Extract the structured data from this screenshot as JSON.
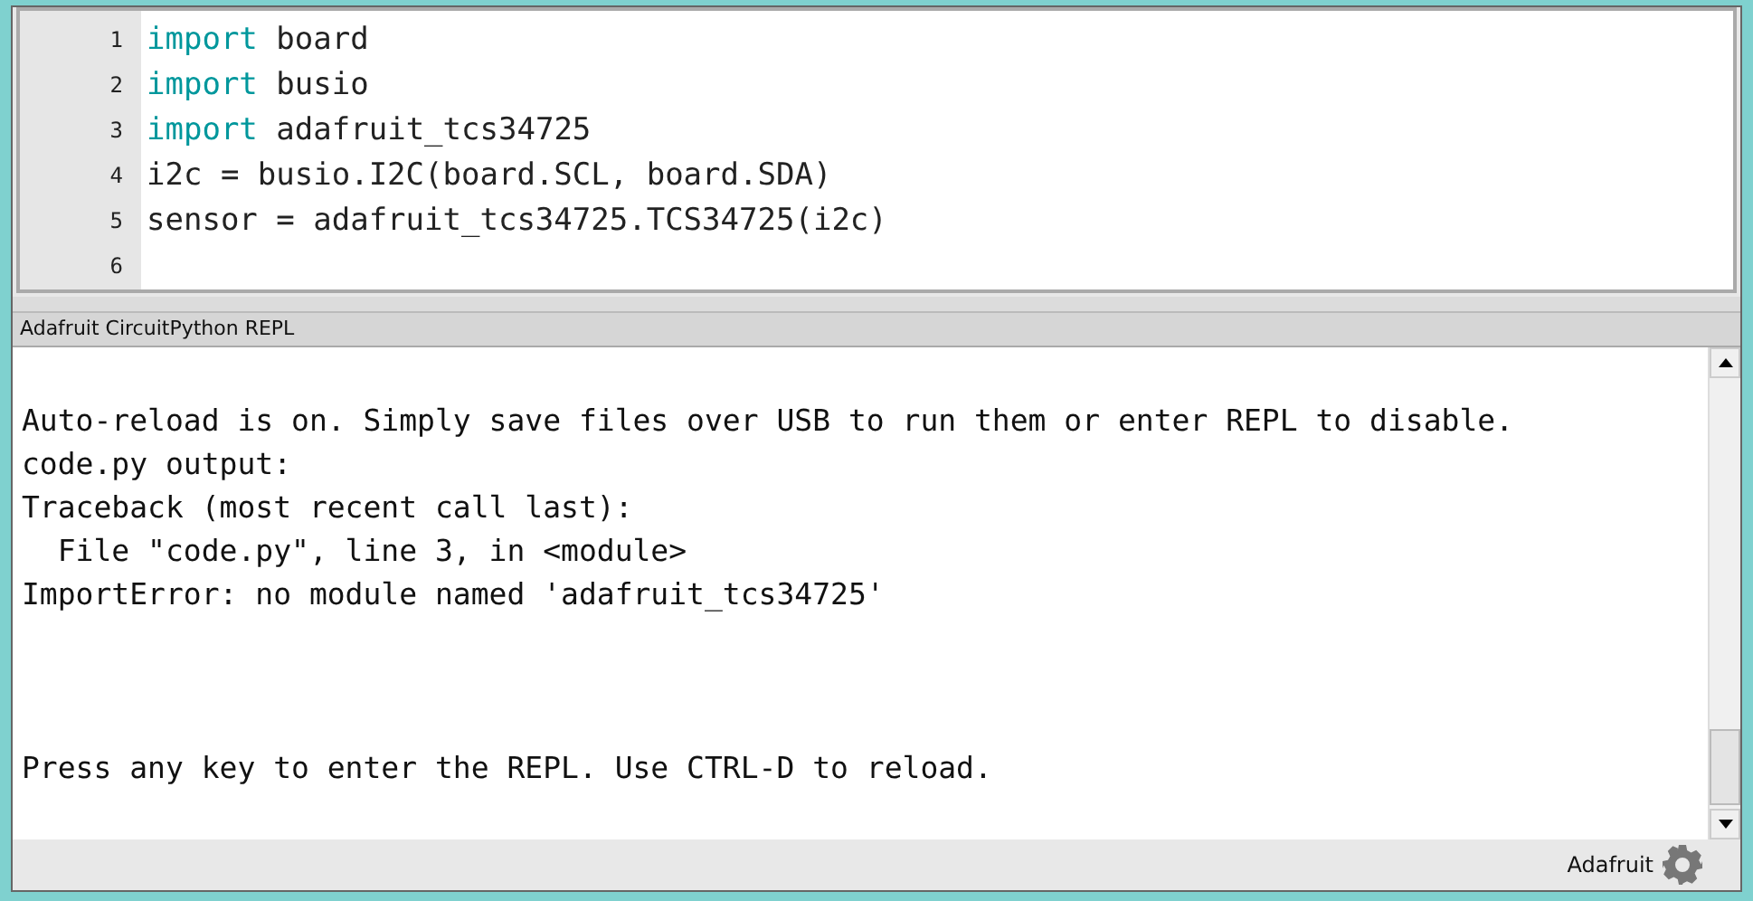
{
  "editor": {
    "lines": [
      {
        "number": "1",
        "keyword": "import",
        "code": "board"
      },
      {
        "number": "2",
        "keyword": "import",
        "code": "busio"
      },
      {
        "number": "3",
        "keyword": "import",
        "code": "adafruit_tcs34725"
      },
      {
        "number": "4",
        "code": "i2c = busio.I2C(board.SCL, board.SDA)"
      },
      {
        "number": "5",
        "code": "sensor = adafruit_tcs34725.TCS34725(i2c)"
      },
      {
        "number": "6"
      }
    ]
  },
  "repl": {
    "title": "Adafruit CircuitPython REPL",
    "output": [
      "Auto-reload is on. Simply save files over USB to run them or enter REPL to disable.",
      "code.py output:",
      "Traceback (most recent call last):",
      "  File \"code.py\", line 3, in <module>",
      "ImportError: no module named 'adafruit_tcs34725'"
    ],
    "prompt": "Press any key to enter the REPL. Use CTRL-D to reload."
  },
  "status_bar": {
    "board": "Adafruit"
  }
}
